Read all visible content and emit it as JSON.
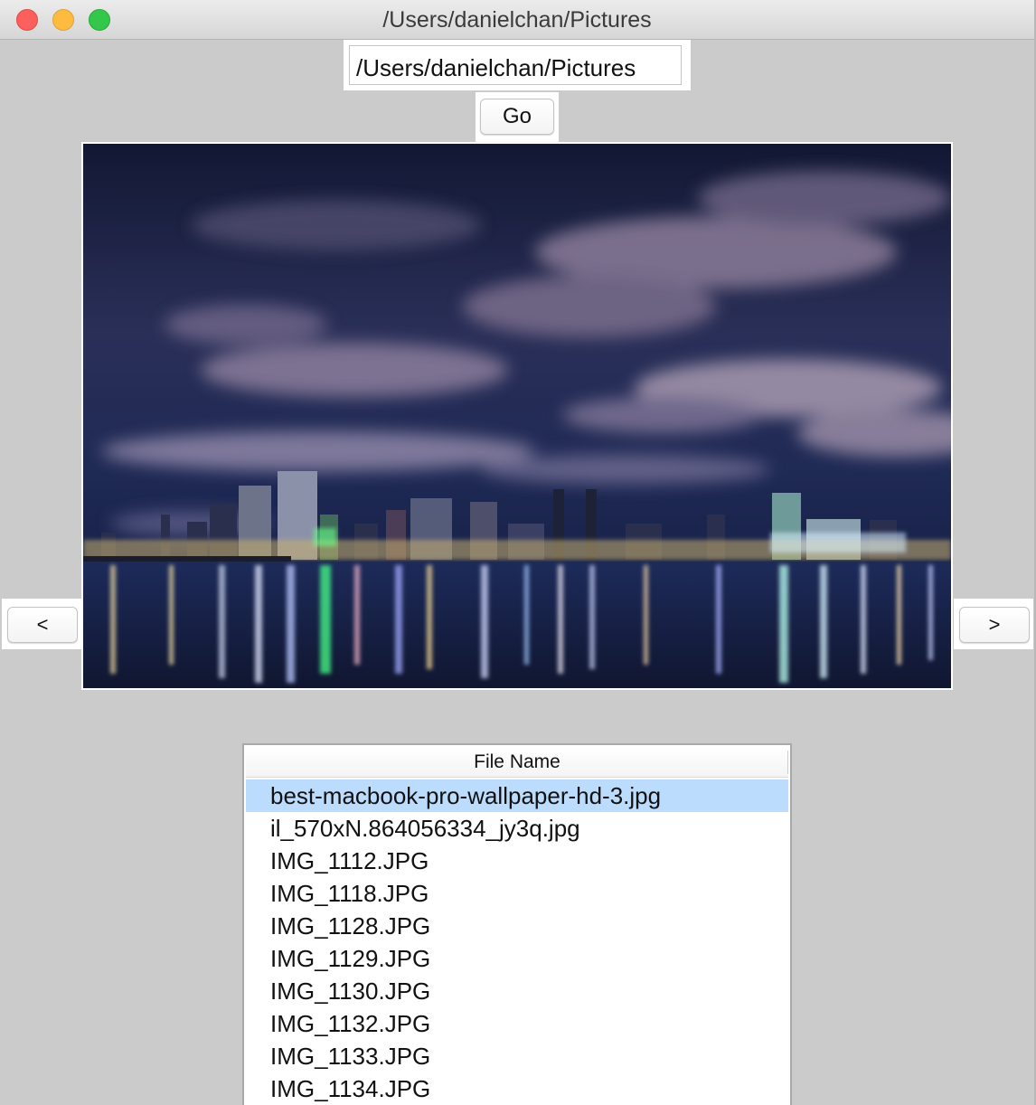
{
  "window": {
    "title": "/Users/danielchan/Pictures"
  },
  "path_bar": {
    "value": "/Users/danielchan/Pictures",
    "go_label": "Go"
  },
  "navigation": {
    "prev_label": "<",
    "next_label": ">"
  },
  "image_viewer": {
    "subject": "night city skyline reflected in water"
  },
  "file_list": {
    "column_header": "File Name",
    "selected_index": 0,
    "rows": [
      "best-macbook-pro-wallpaper-hd-3.jpg",
      "il_570xN.864056334_jy3q.jpg",
      "IMG_1112.JPG",
      "IMG_1118.JPG",
      "IMG_1128.JPG",
      "IMG_1129.JPG",
      "IMG_1130.JPG",
      "IMG_1132.JPG",
      "IMG_1133.JPG",
      "IMG_1134.JPG"
    ]
  },
  "colors": {
    "window_bg": "#cbcbcb",
    "selection": "#bcdcfd",
    "close": "#fc605c",
    "minimize": "#fdbc40",
    "maximize": "#34c84a"
  }
}
